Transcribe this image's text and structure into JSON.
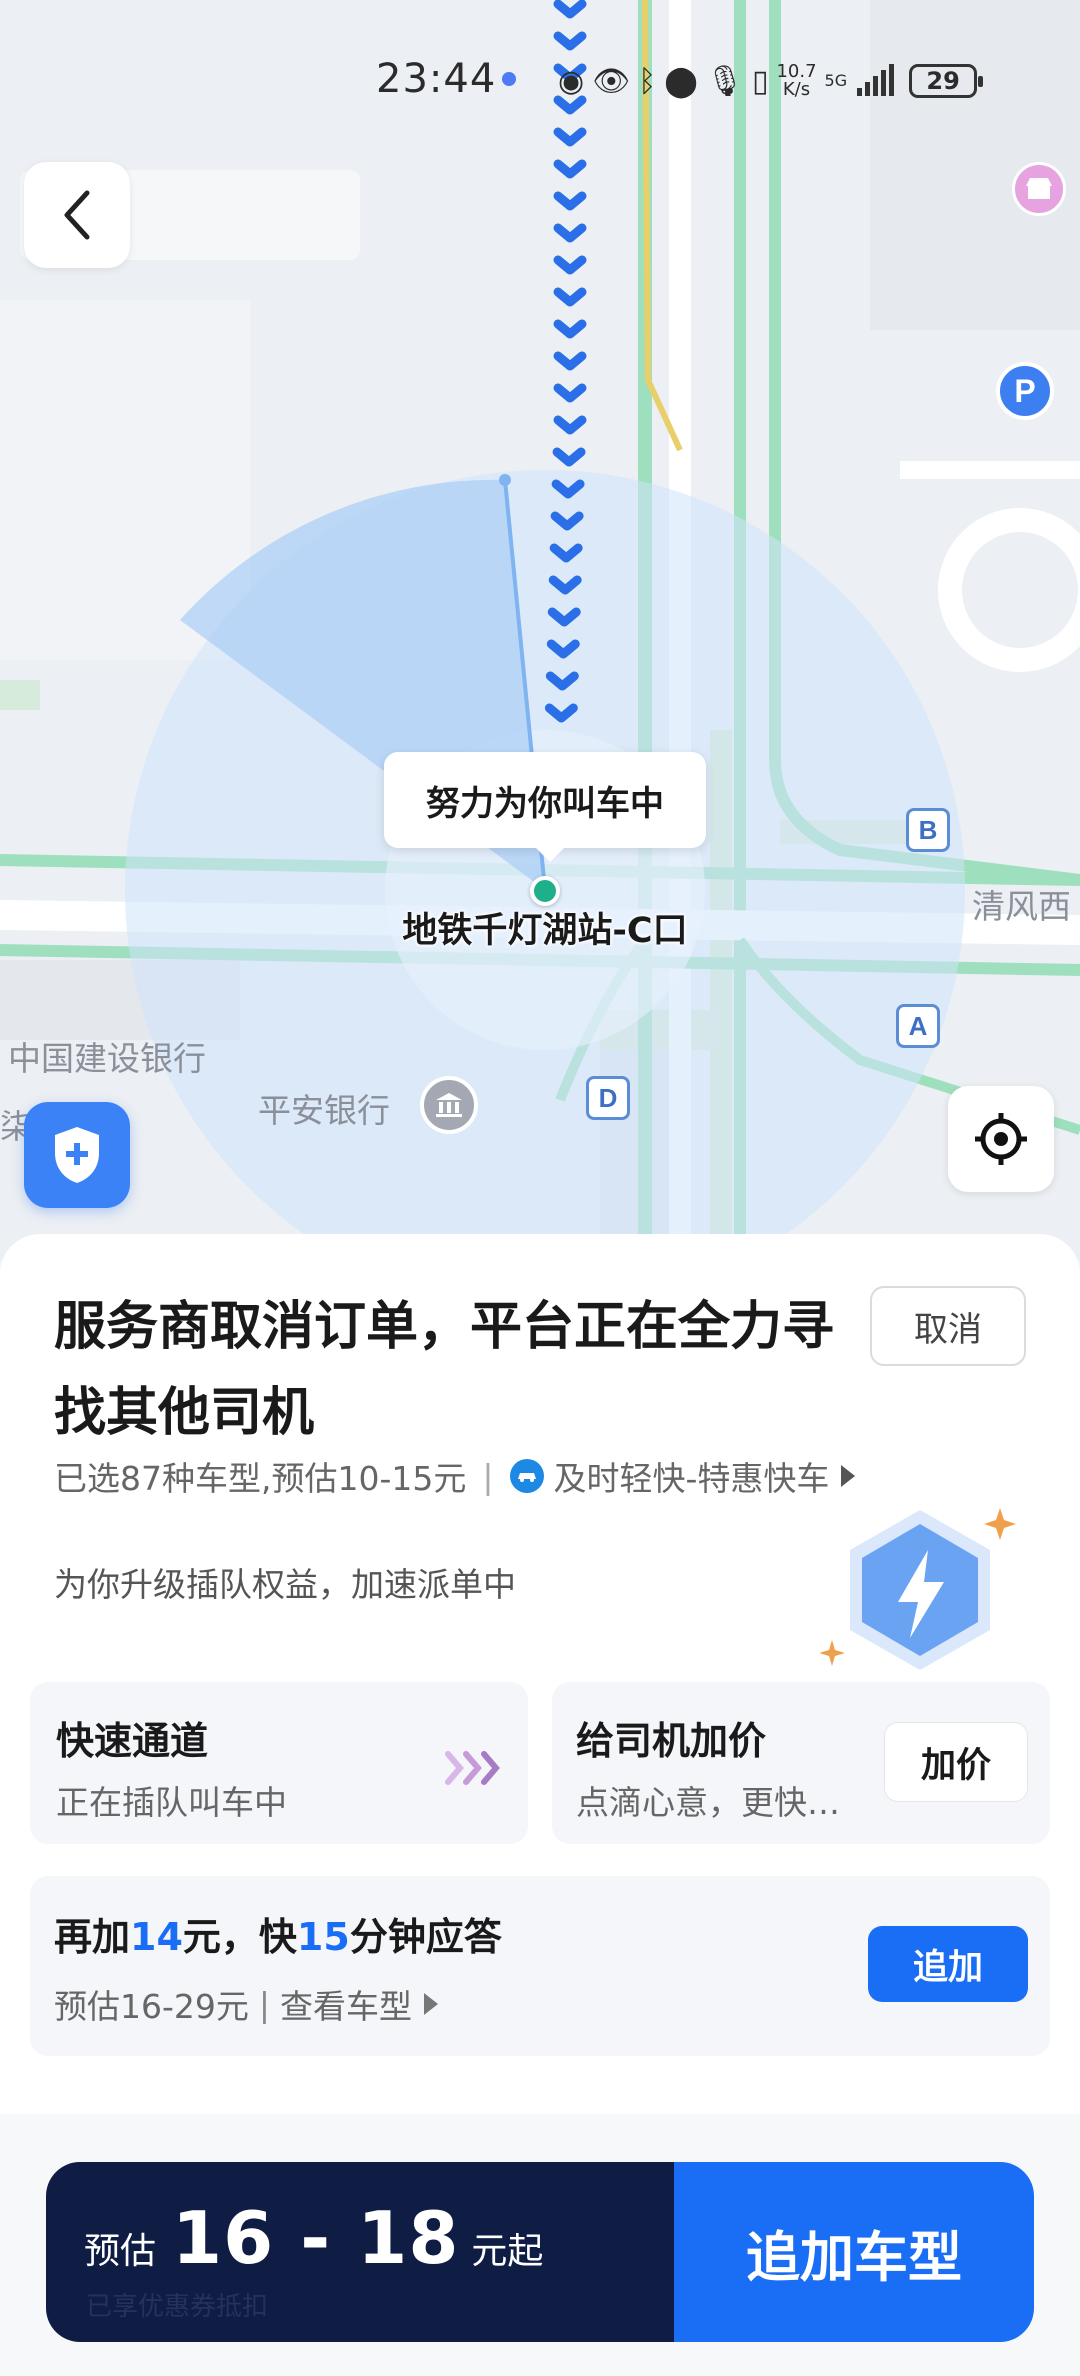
{
  "status_bar": {
    "time": "23:44",
    "speed_top": "10.7",
    "speed_bottom": "K/s",
    "network": "5G",
    "battery": "29"
  },
  "map": {
    "bubble_text": "努力为你叫车中",
    "pickup_label": "地铁千灯湖站-C口",
    "labels": {
      "road_east": "清风西",
      "bank_ccb": "中国建设银行",
      "bank_pingan": "平安银行",
      "partial_label": "柒𬌗座"
    },
    "exit_markers": [
      "B",
      "A",
      "D"
    ],
    "parking_marker": "P"
  },
  "order": {
    "title": "服务商取消订单，平台正在全力寻找其他司机",
    "cancel_label": "取消",
    "selected_info": "已选87种车型,预估10-15元",
    "service_name": "及时轻快-特惠快车",
    "upgrade_text": "为你升级插队权益，加速派单中"
  },
  "fast_lane": {
    "title": "快速通道",
    "subtitle": "正在插队叫车中"
  },
  "tip_driver": {
    "title": "给司机加价",
    "subtitle": "点滴心意，更快…",
    "button_label": "加价"
  },
  "boost": {
    "prefix": "再加",
    "amount": "14",
    "middle": "元，快",
    "minutes": "15",
    "suffix": "分钟应答",
    "estimate": "预估16-29元",
    "link": "查看车型",
    "button_label": "追加"
  },
  "footer": {
    "price_prefix": "预估",
    "price_range": "16 - 18",
    "price_suffix": "元起",
    "note": "已享优惠券抵扣",
    "cta_label": "追加车型"
  },
  "colors": {
    "accent": "#1a6ef5",
    "navy": "#0f1c44",
    "pickup": "#1eb08a",
    "route": "#2b6fe8"
  }
}
